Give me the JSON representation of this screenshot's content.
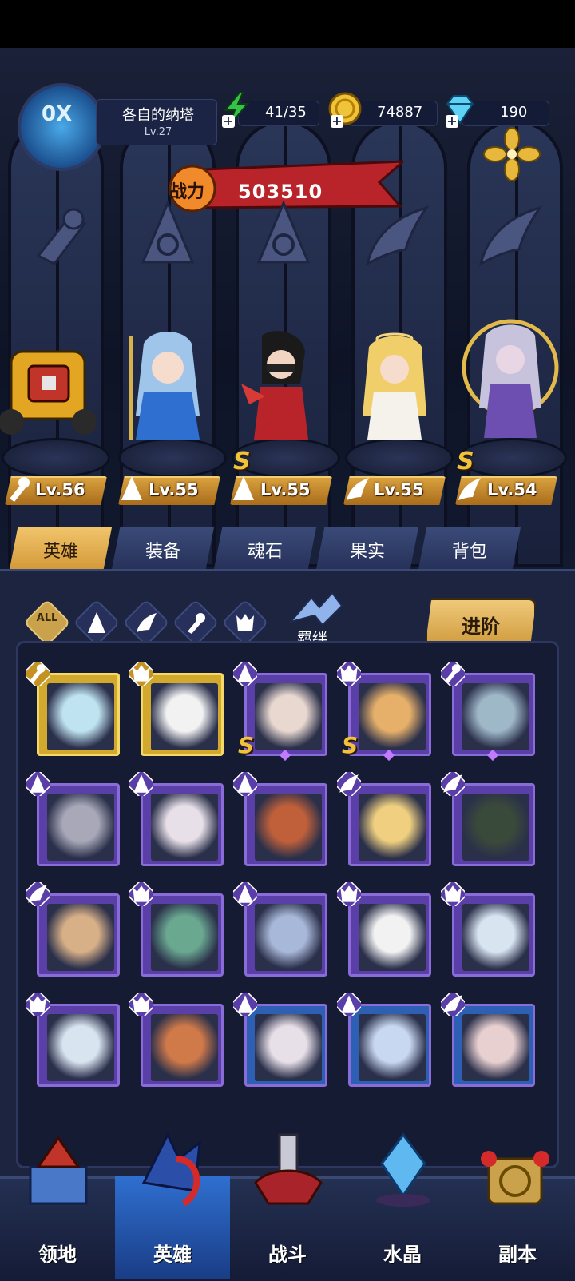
{
  "player": {
    "name": "各自的纳塔",
    "level": "Lv.27",
    "avatar_badge": "0X"
  },
  "resources": {
    "energy": {
      "icon": "lightning-icon",
      "value": "41/35"
    },
    "gold": {
      "icon": "gold-coin-icon",
      "value": "74887"
    },
    "gems": {
      "icon": "diamond-icon",
      "value": "190"
    }
  },
  "power": {
    "label": "战力",
    "value": "503510"
  },
  "lineup": [
    {
      "name": "mech",
      "class_icon": "wrench-icon",
      "level": "Lv.56",
      "s_rank": false
    },
    {
      "name": "ice-sorceress",
      "class_icon": "mage-hat-icon",
      "level": "Lv.55",
      "s_rank": false
    },
    {
      "name": "ninja",
      "class_icon": "mage-hat-icon",
      "level": "Lv.55",
      "s_rank": true
    },
    {
      "name": "angel",
      "class_icon": "wing-icon",
      "level": "Lv.55",
      "s_rank": false
    },
    {
      "name": "moon-priestess",
      "class_icon": "wing-icon",
      "level": "Lv.54",
      "s_rank": true
    }
  ],
  "tabs": [
    "英雄",
    "装备",
    "魂石",
    "果实",
    "背包"
  ],
  "active_tab": "英雄",
  "filters": {
    "all_label": "ALL",
    "bond_label": "羁绊",
    "advance_label": "进阶"
  },
  "roster": [
    {
      "tag": "wrench-icon",
      "frame": "gold",
      "s": false
    },
    {
      "tag": "beast-icon",
      "frame": "gold",
      "s": false
    },
    {
      "tag": "mage-hat-icon",
      "frame": "purple",
      "s": true
    },
    {
      "tag": "beast-icon",
      "frame": "purple",
      "s": true
    },
    {
      "tag": "wrench-icon",
      "frame": "purple",
      "s": false
    },
    {
      "tag": "mage-hat-icon",
      "frame": "purple",
      "s": false
    },
    {
      "tag": "mage-hat-icon",
      "frame": "purple",
      "s": false
    },
    {
      "tag": "mage-hat-icon",
      "frame": "purple",
      "s": false
    },
    {
      "tag": "wing-icon",
      "frame": "purple",
      "s": false
    },
    {
      "tag": "wing-icon",
      "frame": "purple",
      "s": false
    },
    {
      "tag": "wing-icon",
      "frame": "purple",
      "s": false
    },
    {
      "tag": "beast-icon",
      "frame": "purple",
      "s": false
    },
    {
      "tag": "mage-hat-icon",
      "frame": "purple",
      "s": false
    },
    {
      "tag": "beast-icon",
      "frame": "purple",
      "s": false
    },
    {
      "tag": "beast-icon",
      "frame": "purple",
      "s": false
    },
    {
      "tag": "beast-icon",
      "frame": "purple",
      "s": false
    },
    {
      "tag": "beast-icon",
      "frame": "purple",
      "s": false
    },
    {
      "tag": "mage-hat-icon",
      "frame": "blue",
      "s": false
    },
    {
      "tag": "mage-hat-icon",
      "frame": "blue",
      "s": false
    },
    {
      "tag": "wing-icon",
      "frame": "blue",
      "s": false
    }
  ],
  "nav": [
    "领地",
    "英雄",
    "战斗",
    "水晶",
    "副本"
  ],
  "active_nav": "英雄",
  "colors": {
    "gold": "#d9a13e",
    "purple_frame": "#5b3fa8",
    "blue_frame": "#2d5fb4",
    "gold_frame": "#d2a92c"
  }
}
